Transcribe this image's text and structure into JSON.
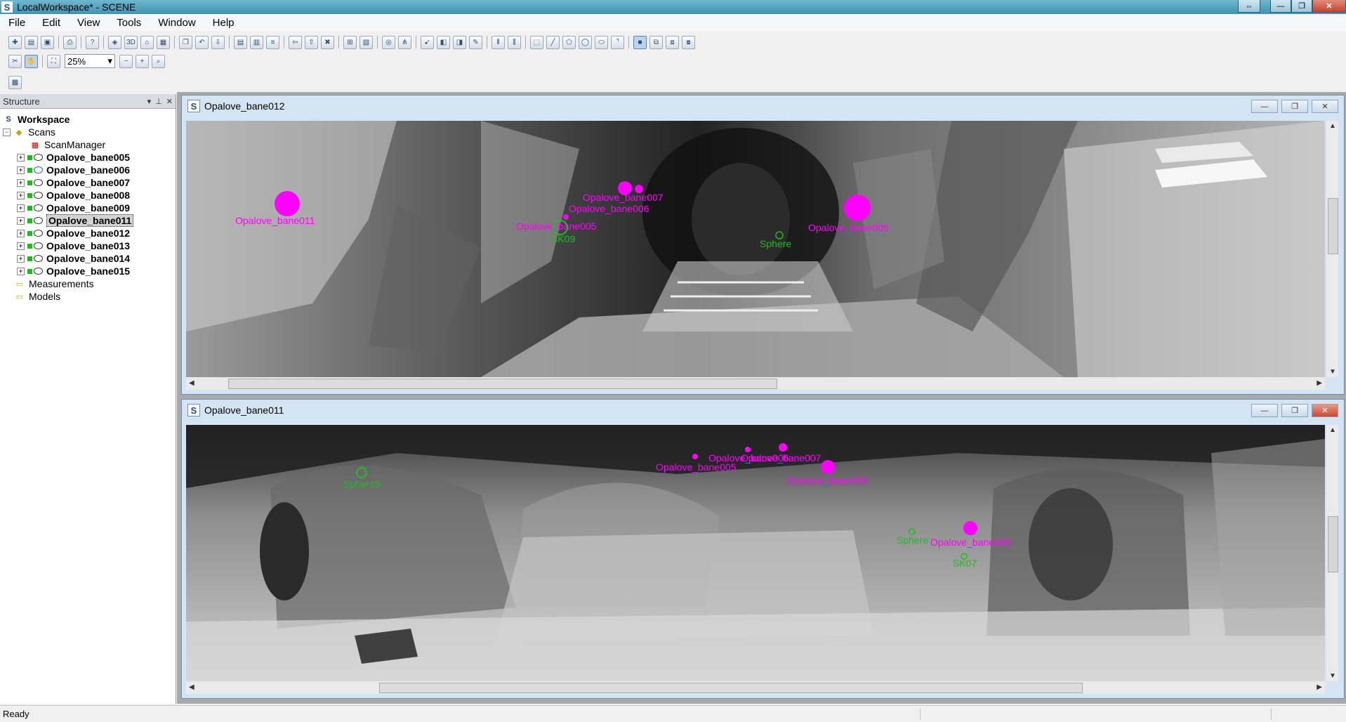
{
  "app": {
    "title": "LocalWorkspace* - SCENE",
    "icon_letter": "S"
  },
  "window_buttons": {
    "extra": "⇔",
    "minimize": "—",
    "maximize": "❐",
    "close": "✕"
  },
  "menu": [
    "File",
    "Edit",
    "View",
    "Tools",
    "Window",
    "Help"
  ],
  "toolbar": {
    "zoom_value": "25%"
  },
  "structure_panel": {
    "title": "Structure",
    "workspace": "Workspace",
    "scans_label": "Scans",
    "scan_manager": "ScanManager",
    "scans": [
      "Opalove_bane005",
      "Opalove_bane006",
      "Opalove_bane007",
      "Opalove_bane008",
      "Opalove_bane009",
      "Opalove_bane011",
      "Opalove_bane012",
      "Opalove_bane013",
      "Opalove_bane014",
      "Opalove_bane015"
    ],
    "selected_scan": "Opalove_bane011",
    "measurements": "Measurements",
    "models": "Models"
  },
  "views": [
    {
      "title": "Opalove_bane012",
      "markers": [
        {
          "label": "Opalove_bane011",
          "color": "#ff00ff"
        },
        {
          "label": "Opalove_bane007",
          "color": "#ff00ff"
        },
        {
          "label": "Opalove_bane006",
          "color": "#ff00ff"
        },
        {
          "label": "Opalove_bane005",
          "color": "#ff00ff"
        },
        {
          "label": "Opalove_bane009",
          "color": "#ff00ff"
        },
        {
          "label": "SK09",
          "color": "#22bb22"
        },
        {
          "label": "Sphere",
          "color": "#22bb22"
        }
      ]
    },
    {
      "title": "Opalove_bane011",
      "markers": [
        {
          "label": "Sphere5",
          "color": "#22bb22"
        },
        {
          "label": "Opalove_bane005",
          "color": "#ff00ff"
        },
        {
          "label": "Opalove_bane006",
          "color": "#ff00ff"
        },
        {
          "label": "Opalove_bane007",
          "color": "#ff00ff"
        },
        {
          "label": "Opalove_bane008",
          "color": "#ff00ff"
        },
        {
          "label": "Sphere",
          "color": "#22bb22"
        },
        {
          "label": "Opalove_bane009",
          "color": "#ff00ff"
        },
        {
          "label": "SK07",
          "color": "#22bb22"
        }
      ]
    }
  ],
  "status": {
    "text": "Ready"
  }
}
